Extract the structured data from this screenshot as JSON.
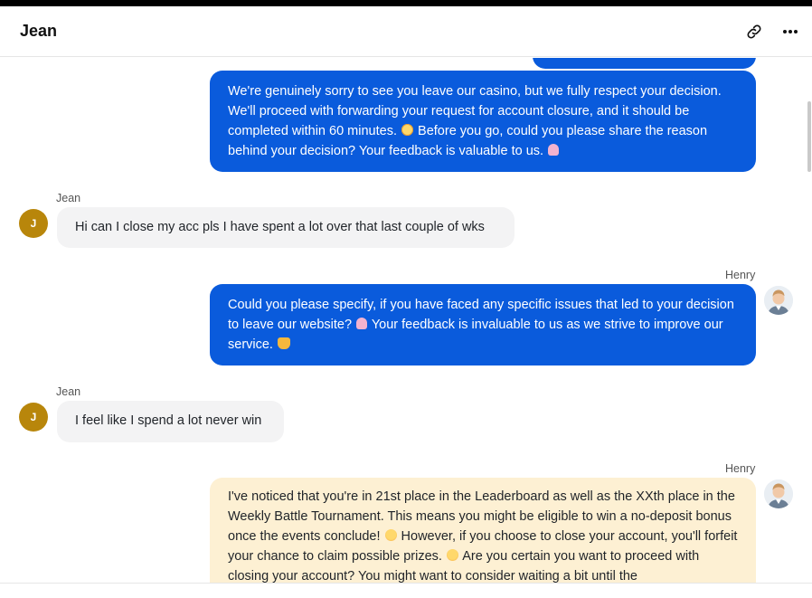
{
  "header": {
    "title": "Jean",
    "link_icon": "link-icon",
    "more_icon": "more-horizontal-icon"
  },
  "colors": {
    "agent_bubble": "#0a5bdc",
    "customer_bubble": "#f3f3f4",
    "warning_bubble": "#fdf0d3",
    "customer_avatar": "#b8860b"
  },
  "messages": [
    {
      "sender": "Henry",
      "text_parts": [
        "We're genuinely sorry to see you leave our casino, but we fully respect your decision. We'll proceed with forwarding your request for account closure, and it should be completed within 60 minutes. ",
        " Before you go, could you please share the reason behind your decision? Your feedback is valuable to us. "
      ]
    },
    {
      "sender": "Jean",
      "avatar_initial": "J",
      "text": "Hi can I close my acc pls I have spent a lot over that last couple of wks"
    },
    {
      "sender": "Henry",
      "text_parts": [
        "Could you please specify, if you have faced any specific issues that led to your decision to leave our website? ",
        " Your feedback is invaluable to us as we strive to improve our service. "
      ]
    },
    {
      "sender": "Jean",
      "avatar_initial": "J",
      "text": "I feel like I spend a lot never win"
    },
    {
      "sender": "Henry",
      "text_parts": [
        "I've noticed that you're in 21st place in the Leaderboard as well as the XXth place in the Weekly Battle Tournament. This means you might be eligible to win a no-deposit bonus once the events conclude! ",
        " However, if you choose to close your account, you'll forfeit your chance to claim possible prizes. ",
        " Are you certain you want to proceed with closing your account? You might want to consider waiting a bit until the"
      ]
    }
  ]
}
